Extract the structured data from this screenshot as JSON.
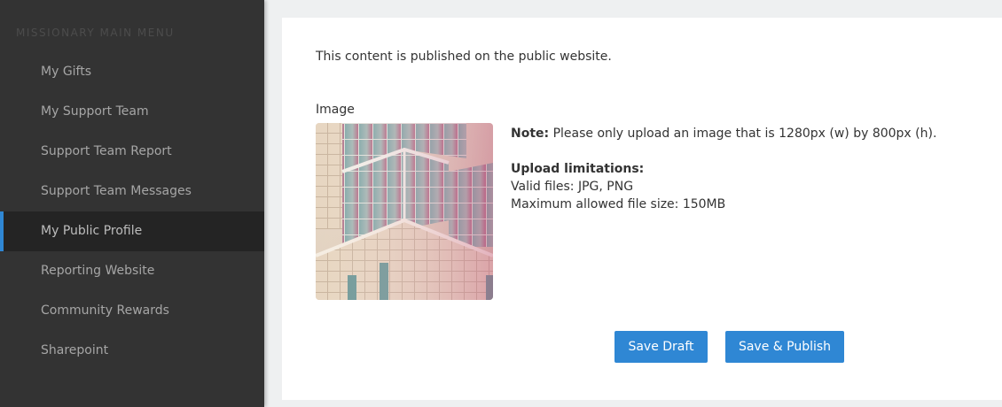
{
  "sidebar": {
    "heading": "MISSIONARY MAIN MENU",
    "items": [
      {
        "label": "My Gifts"
      },
      {
        "label": "My Support Team"
      },
      {
        "label": "Support Team Report"
      },
      {
        "label": "Support Team Messages"
      },
      {
        "label": "My Public Profile",
        "active": true
      },
      {
        "label": "Reporting Website"
      },
      {
        "label": "Community Rewards"
      },
      {
        "label": "Sharepoint"
      }
    ]
  },
  "main": {
    "intro": "This content is published on the public website.",
    "image_label": "Image",
    "image_icon": "building-photo",
    "note_label": "Note:",
    "note_text": " Please only upload an image that is 1280px (w) by 800px (h).",
    "upload_title": "Upload limitations:",
    "valid_files": "Valid files: JPG, PNG",
    "max_size": "Maximum allowed file size: 150MB"
  },
  "actions": {
    "save_draft": "Save Draft",
    "save_publish": "Save & Publish"
  },
  "colors": {
    "accent": "#2f87d4",
    "sidebar_bg": "#333333",
    "active_bg": "#242424"
  }
}
